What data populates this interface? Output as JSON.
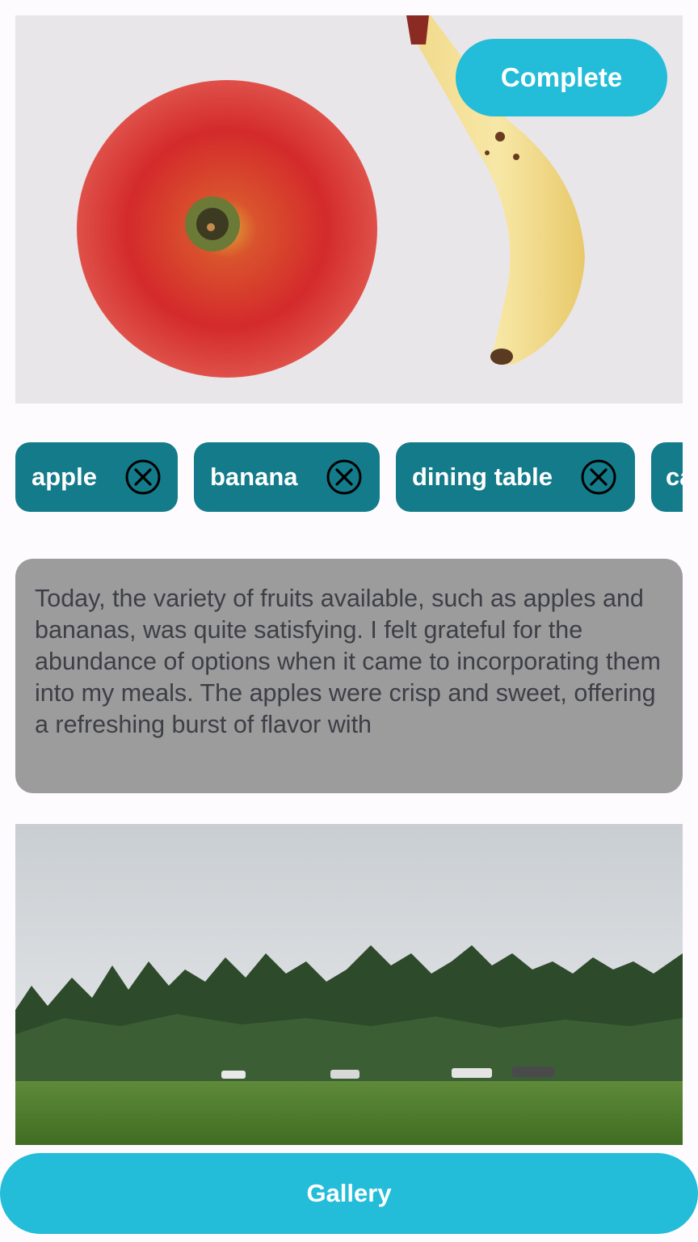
{
  "top_photo": {
    "description_icon": "apple-banana-photo"
  },
  "complete_button": {
    "label": "Complete"
  },
  "tags": [
    {
      "label": "apple"
    },
    {
      "label": "banana"
    },
    {
      "label": "dining table"
    },
    {
      "label": "ca"
    }
  ],
  "caption": {
    "text": "Today, the variety of fruits available, such as apples and bananas, was quite satisfying. I felt grateful for the abundance of options when it came to incorporating them into my meals. The apples were crisp and sweet, offering a refreshing burst of flavor with"
  },
  "bottom_photo": {
    "description_icon": "park-trees-photo"
  },
  "gallery_button": {
    "label": "Gallery"
  },
  "colors": {
    "accent": "#23bcd9",
    "tag_bg": "#137b8a",
    "card_bg": "#9c9c9c",
    "card_text": "#3e3f46"
  }
}
